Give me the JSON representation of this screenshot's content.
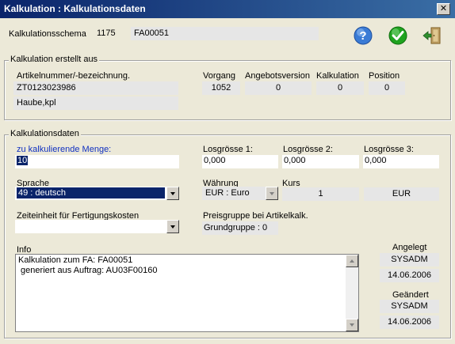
{
  "window": {
    "title": "Kalkulation : Kalkulationsdaten",
    "close_glyph": "✕"
  },
  "header": {
    "schema_label": "Kalkulationsschema",
    "schema_number": "1175",
    "schema_code": "FA00051"
  },
  "toolbar": {
    "help_icon": "help-icon",
    "ok_icon": "checkmark-icon",
    "exit_icon": "exit-door-icon",
    "colors": {
      "help": "#3a7bd5",
      "ok": "#1fa31f",
      "exit": "#2f8f2f"
    }
  },
  "created": {
    "legend": "Kalkulation erstellt aus",
    "article_label": "Artikelnummer/-bezeichnung.",
    "article_number": "ZT0123023986",
    "article_name": "Haube,kpl",
    "vorgang_label": "Vorgang",
    "vorgang_value": "1052",
    "angebotsversion_label": "Angebotsversion",
    "angebotsversion_value": "0",
    "kalkulation_label": "Kalkulation",
    "kalkulation_value": "0",
    "position_label": "Position",
    "position_value": "0"
  },
  "data": {
    "legend": "Kalkulationsdaten",
    "menge_label": "zu kalkulierende Menge:",
    "menge_value": "10",
    "los1_label": "Losgrösse 1:",
    "los1_value": "0,000",
    "los2_label": "Losgrösse 2:",
    "los2_value": "0,000",
    "los3_label": "Losgrösse 3:",
    "los3_value": "0,000",
    "sprache_label": "Sprache",
    "sprache_value": "49 : deutsch",
    "waehrung_label": "Währung",
    "waehrung_value": "EUR : Euro",
    "kurs_label": "Kurs",
    "kurs_value": "1",
    "currency_code": "EUR",
    "zeiteinheit_label": "Zeiteinheit für Fertigungskosten",
    "zeiteinheit_value": "",
    "preisgruppe_label": "Preisgruppe bei Artikelkalk.",
    "preisgruppe_value": "Grundgruppe : 0",
    "info_label": "Info",
    "info_lines": "Kalkulation zum FA: FA00051\n generiert aus Auftrag: AU03F00160",
    "angelegt_label": "Angelegt",
    "angelegt_user": "SYSADM",
    "angelegt_date": "14.06.2006",
    "geaendert_label": "Geändert",
    "geaendert_user": "SYSADM",
    "geaendert_date": "14.06.2006"
  }
}
